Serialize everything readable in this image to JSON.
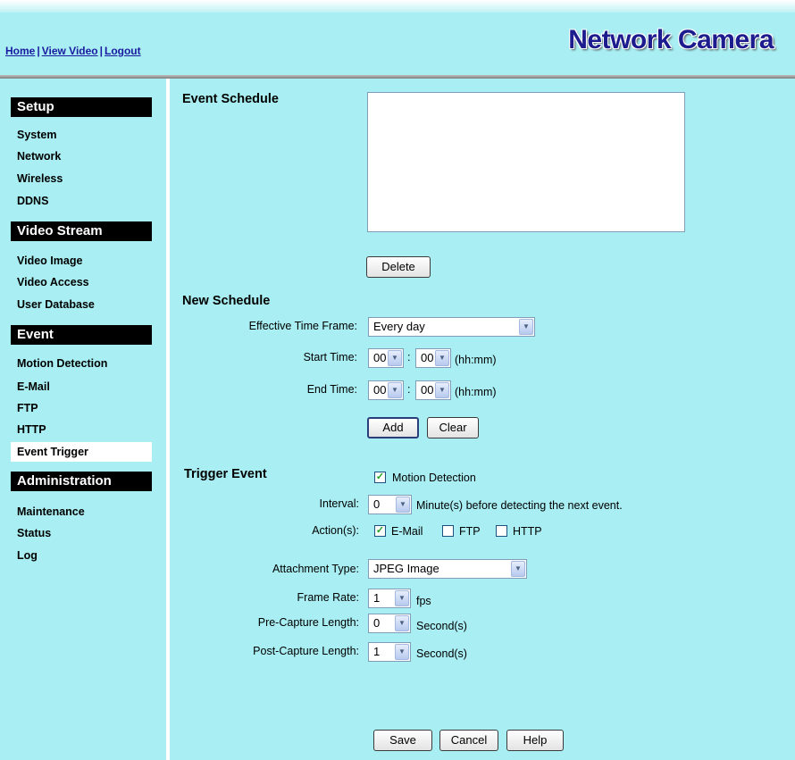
{
  "header": {
    "links": [
      "Home",
      "View Video",
      "Logout"
    ],
    "separator": "|",
    "brand": "Network Camera"
  },
  "sidebar": {
    "sections": [
      {
        "title": "Setup",
        "items": [
          "System",
          "Network",
          "Wireless",
          "DDNS"
        ]
      },
      {
        "title": "Video Stream",
        "items": [
          "Video Image",
          "Video Access",
          "User Database"
        ]
      },
      {
        "title": "Event",
        "items": [
          "Motion Detection",
          "E-Mail",
          "FTP",
          "HTTP",
          "Event Trigger"
        ]
      },
      {
        "title": "Administration",
        "items": [
          "Maintenance",
          "Status",
          "Log"
        ]
      }
    ],
    "active_item": "Event Trigger"
  },
  "event_schedule": {
    "title": "Event Schedule",
    "delete_label": "Delete"
  },
  "new_schedule": {
    "title": "New Schedule",
    "time_frame_label": "Effective Time Frame:",
    "time_frame_value": "Every day",
    "start_label": "Start Time:",
    "start_hour": "00",
    "start_min": "00",
    "end_label": "End Time:",
    "end_hour": "00",
    "end_min": "00",
    "colon": ":",
    "unit": "(hh:mm)",
    "add_label": "Add",
    "clear_label": "Clear"
  },
  "trigger": {
    "title": "Trigger Event",
    "motion_label": "Motion Detection",
    "motion_checked": true,
    "interval_label": "Interval:",
    "interval_value": "0",
    "interval_suffix": "Minute(s) before detecting the next event.",
    "actions_label": "Action(s):",
    "email_label": "E-Mail",
    "email_checked": true,
    "ftp_label": "FTP",
    "ftp_checked": false,
    "http_label": "HTTP",
    "http_checked": false,
    "attachment_label": "Attachment Type:",
    "attachment_value": "JPEG Image",
    "frame_rate_label": "Frame Rate:",
    "frame_rate_value": "1",
    "frame_rate_unit": "fps",
    "pre_label": "Pre-Capture Length:",
    "pre_value": "0",
    "pre_unit": "Second(s)",
    "post_label": "Post-Capture Length:",
    "post_value": "1",
    "post_unit": "Second(s)"
  },
  "footer": {
    "save_label": "Save",
    "cancel_label": "Cancel",
    "help_label": "Help"
  },
  "icons": {
    "dropdown_arrow": "chevron-down-icon",
    "check_mark": "check-icon"
  },
  "colors": {
    "background": "#a8eef2",
    "brand": "#1c1c8f",
    "link": "#1a1aa0",
    "section_bar": "#000000",
    "check": "#21a121"
  }
}
